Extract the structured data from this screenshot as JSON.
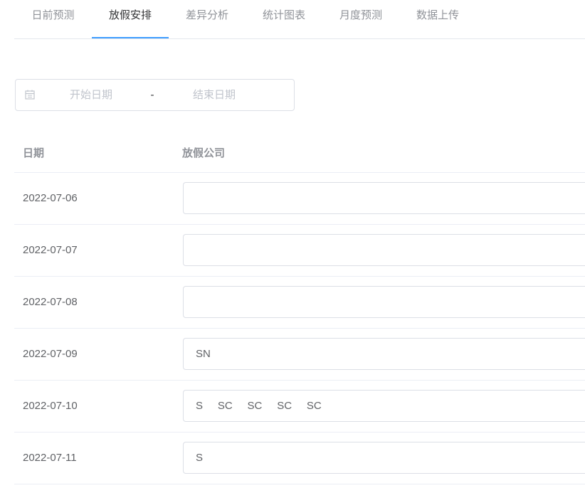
{
  "tabs": [
    {
      "label": "日前预测",
      "active": false
    },
    {
      "label": "放假安排",
      "active": true
    },
    {
      "label": "差异分析",
      "active": false
    },
    {
      "label": "统计图表",
      "active": false
    },
    {
      "label": "月度预测",
      "active": false
    },
    {
      "label": "数据上传",
      "active": false
    }
  ],
  "date_range": {
    "start_placeholder": "开始日期",
    "separator": "-",
    "end_placeholder": "结束日期"
  },
  "table": {
    "headers": {
      "date": "日期",
      "company": "放假公司"
    },
    "rows": [
      {
        "date": "2022-07-06",
        "company": ""
      },
      {
        "date": "2022-07-07",
        "company": ""
      },
      {
        "date": "2022-07-08",
        "company": ""
      },
      {
        "date": "2022-07-09",
        "company": "SN"
      },
      {
        "date": "2022-07-10",
        "company": "S     SC     SC     SC     SC"
      },
      {
        "date": "2022-07-11",
        "company": "S"
      }
    ]
  },
  "colors": {
    "accent": "#409eff",
    "border": "#dcdfe6",
    "text_primary": "#303133",
    "text_secondary": "#909399",
    "text_regular": "#606266",
    "placeholder": "#c0c4cc"
  }
}
